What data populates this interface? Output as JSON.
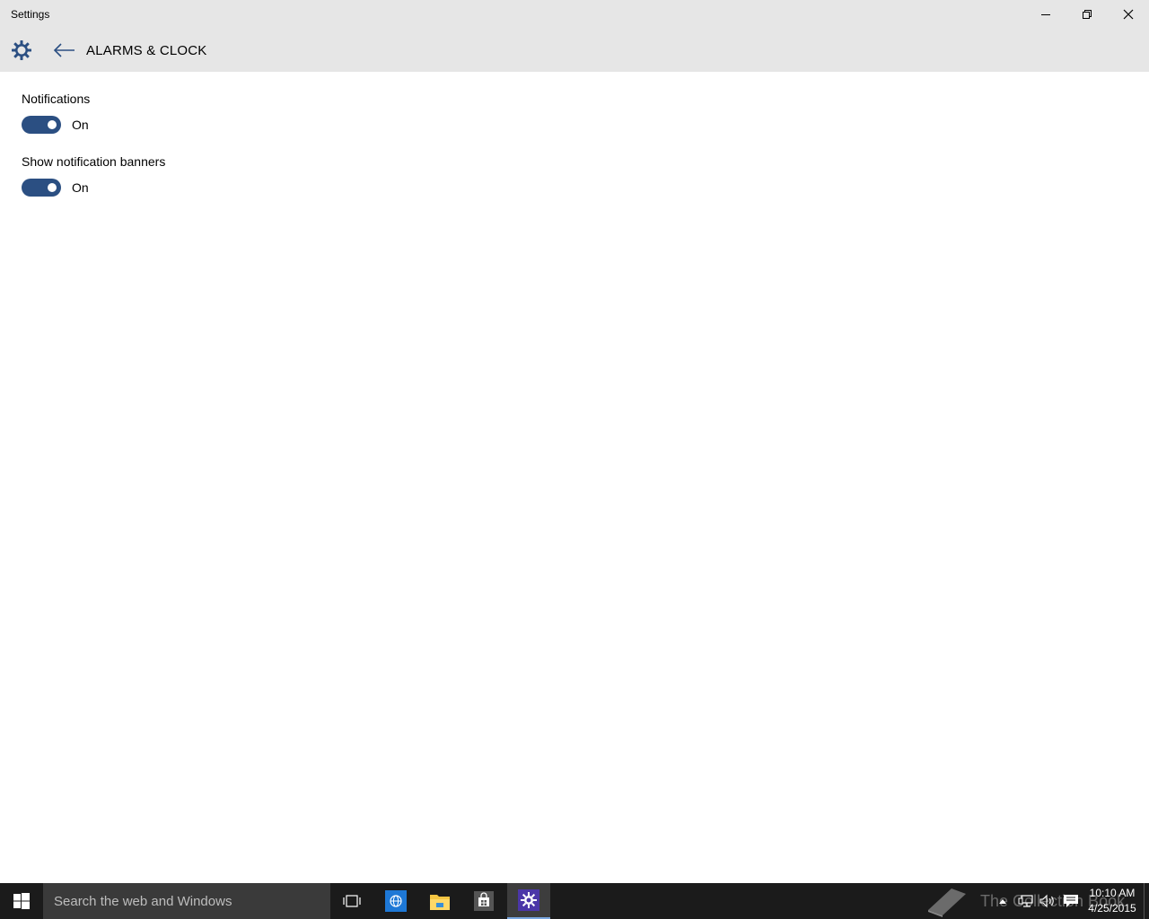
{
  "window": {
    "title": "Settings",
    "controls": {
      "minimize": "minimize-icon",
      "restore": "restore-icon",
      "close": "close-icon"
    }
  },
  "header": {
    "settings_icon": "gear-icon",
    "back_icon": "back-arrow-icon",
    "page_title": "ALARMS & CLOCK"
  },
  "settings": [
    {
      "label": "Notifications",
      "toggle_state": "On",
      "enabled": true
    },
    {
      "label": "Show notification banners",
      "toggle_state": "On",
      "enabled": true
    }
  ],
  "taskbar": {
    "search_placeholder": "Search the web and Windows",
    "apps": [
      "task-view-icon",
      "browser-icon",
      "file-explorer-icon",
      "store-icon",
      "settings-icon"
    ],
    "active_app": "settings-icon",
    "watermark_text": "The Collection Book",
    "clock": {
      "time": "10:10 AM",
      "date": "4/25/2015"
    }
  },
  "colors": {
    "accent": "#2b4f82",
    "titlebar": "#e6e6e6",
    "taskbar": "#1b1b1b",
    "search_box": "#3a3a3a"
  }
}
